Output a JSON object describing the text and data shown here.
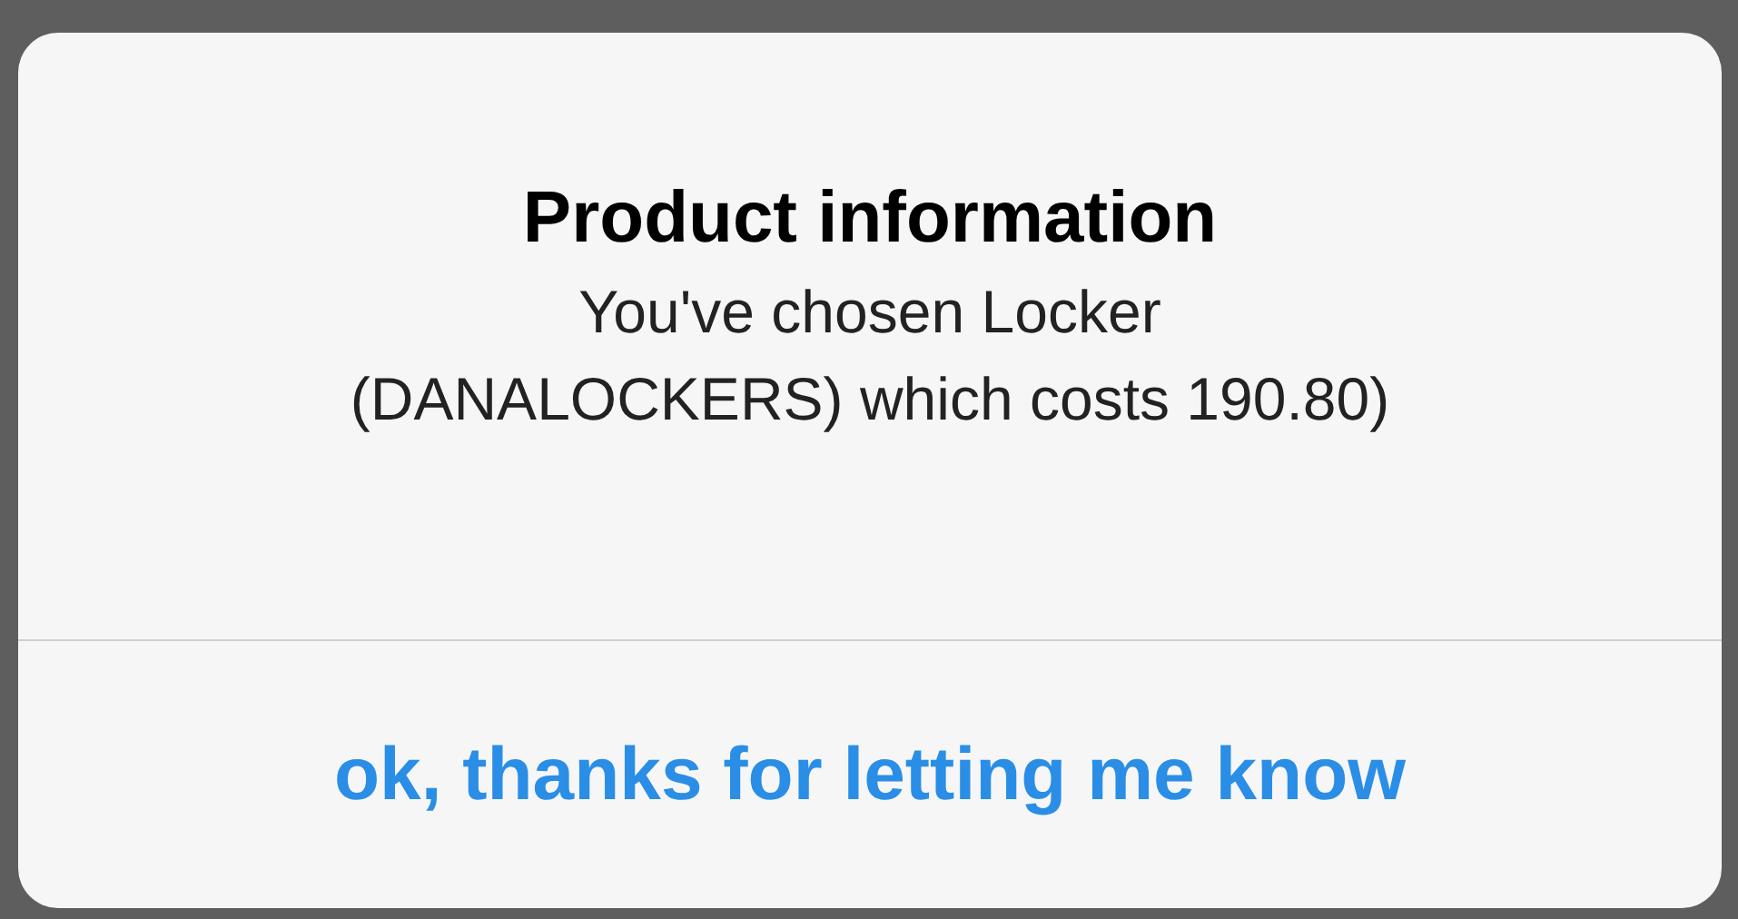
{
  "alert": {
    "title": "Product information",
    "message_lines": [
      "You've chosen Locker",
      "(DANALOCKERS) which costs 190.80)"
    ],
    "buttons": [
      {
        "label": "ok, thanks for letting me know"
      }
    ]
  }
}
